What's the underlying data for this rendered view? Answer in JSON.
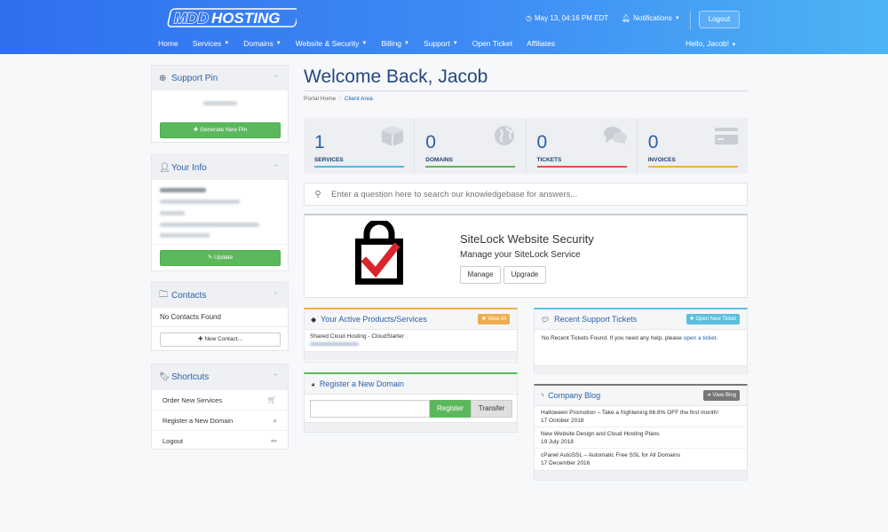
{
  "header": {
    "datetime": "May 13, 04:16 PM EDT",
    "notifications": "Notifications",
    "logout": "Logout",
    "nav": [
      "Home",
      "Services",
      "Domains",
      "Website & Security",
      "Billing",
      "Support",
      "Open Ticket",
      "Affiliates"
    ],
    "nav_dropdown": [
      false,
      true,
      true,
      true,
      true,
      true,
      false,
      false
    ],
    "greeting": "Hello, Jacob!"
  },
  "sidebar": {
    "support_pin": {
      "title": "Support Pin",
      "button": "Generate New Pin"
    },
    "your_info": {
      "title": "Your Info",
      "button": "Update"
    },
    "contacts": {
      "title": "Contacts",
      "empty": "No Contacts Found",
      "button": "New Contact..."
    },
    "shortcuts": {
      "title": "Shortcuts",
      "items": [
        "Order New Services",
        "Register a New Domain",
        "Logout"
      ]
    }
  },
  "main": {
    "title": "Welcome Back, Jacob",
    "breadcrumb": [
      "Portal Home",
      "Client Area"
    ],
    "stats": [
      {
        "value": "1",
        "label": "SERVICES",
        "color": "#5bb3e6",
        "icon": "cube-icon"
      },
      {
        "value": "0",
        "label": "DOMAINS",
        "color": "#5cb85c",
        "icon": "globe-icon"
      },
      {
        "value": "0",
        "label": "TICKETS",
        "color": "#d9534f",
        "icon": "comments-icon"
      },
      {
        "value": "0",
        "label": "INVOICES",
        "color": "#f0ad4e",
        "icon": "credit-card-icon"
      }
    ],
    "search_placeholder": "Enter a question here to search our knowledgebase for answers...",
    "sitelock": {
      "title": "SiteLock Website Security",
      "subtitle": "Manage your SiteLock Service",
      "manage": "Manage",
      "upgrade": "Upgrade"
    },
    "products": {
      "title": "Your Active Products/Services",
      "button": "View All",
      "item": "Shared Cloud Hosting - CloudStarter"
    },
    "register_domain": {
      "title": "Register a New Domain",
      "register": "Register",
      "transfer": "Transfer"
    },
    "tickets": {
      "title": "Recent Support Tickets",
      "button": "Open New Ticket",
      "text": "No Recent Tickets Found. If you need any help, please",
      "link": "open a ticket",
      "after": "."
    },
    "blog": {
      "title": "Company Blog",
      "button": "View Blog",
      "posts": [
        {
          "title": "Halloween Promotion – Take a frightening 66.6% OFF the first month!",
          "date": "17 October 2018"
        },
        {
          "title": "New Website Design and Cloud Hosting Plans",
          "date": "19 July 2018"
        },
        {
          "title": "cPanel AutoSSL – Automatic Free SSL for All Domains",
          "date": "17 December 2016"
        }
      ]
    }
  },
  "colors": {
    "primary": "#2b5fa9",
    "green": "#5cb85c",
    "orange": "#f0ad4e",
    "teal": "#5bc0de",
    "gray": "#777777"
  }
}
